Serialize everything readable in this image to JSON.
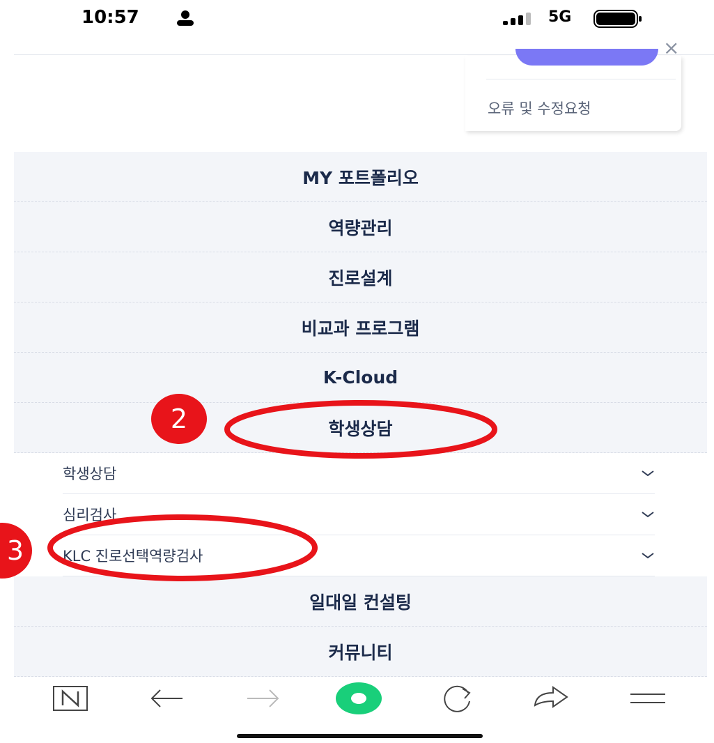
{
  "status_bar": {
    "time": "10:57",
    "network": "5G"
  },
  "card": {
    "report_label": "오류 및 수정요청"
  },
  "menu": {
    "items_top": [
      {
        "label": "MY 포트폴리오"
      },
      {
        "label": "역량관리"
      },
      {
        "label": "진로설계"
      },
      {
        "label": "비교과 프로그램"
      },
      {
        "label": "K-Cloud"
      },
      {
        "label": "학생상담"
      }
    ],
    "submenu": [
      {
        "label": "학생상담"
      },
      {
        "label": "심리검사"
      },
      {
        "label": "KLC 진로선택역량검사"
      }
    ],
    "items_bottom": [
      {
        "label": "일대일 컨설팅"
      },
      {
        "label": "커뮤니티"
      }
    ]
  },
  "annotations": {
    "badge_2": "2",
    "badge_3": "3"
  },
  "colors": {
    "menu_bg": "#f3f5f9",
    "accent": "#7b78f5",
    "annotation": "#e8141a"
  }
}
